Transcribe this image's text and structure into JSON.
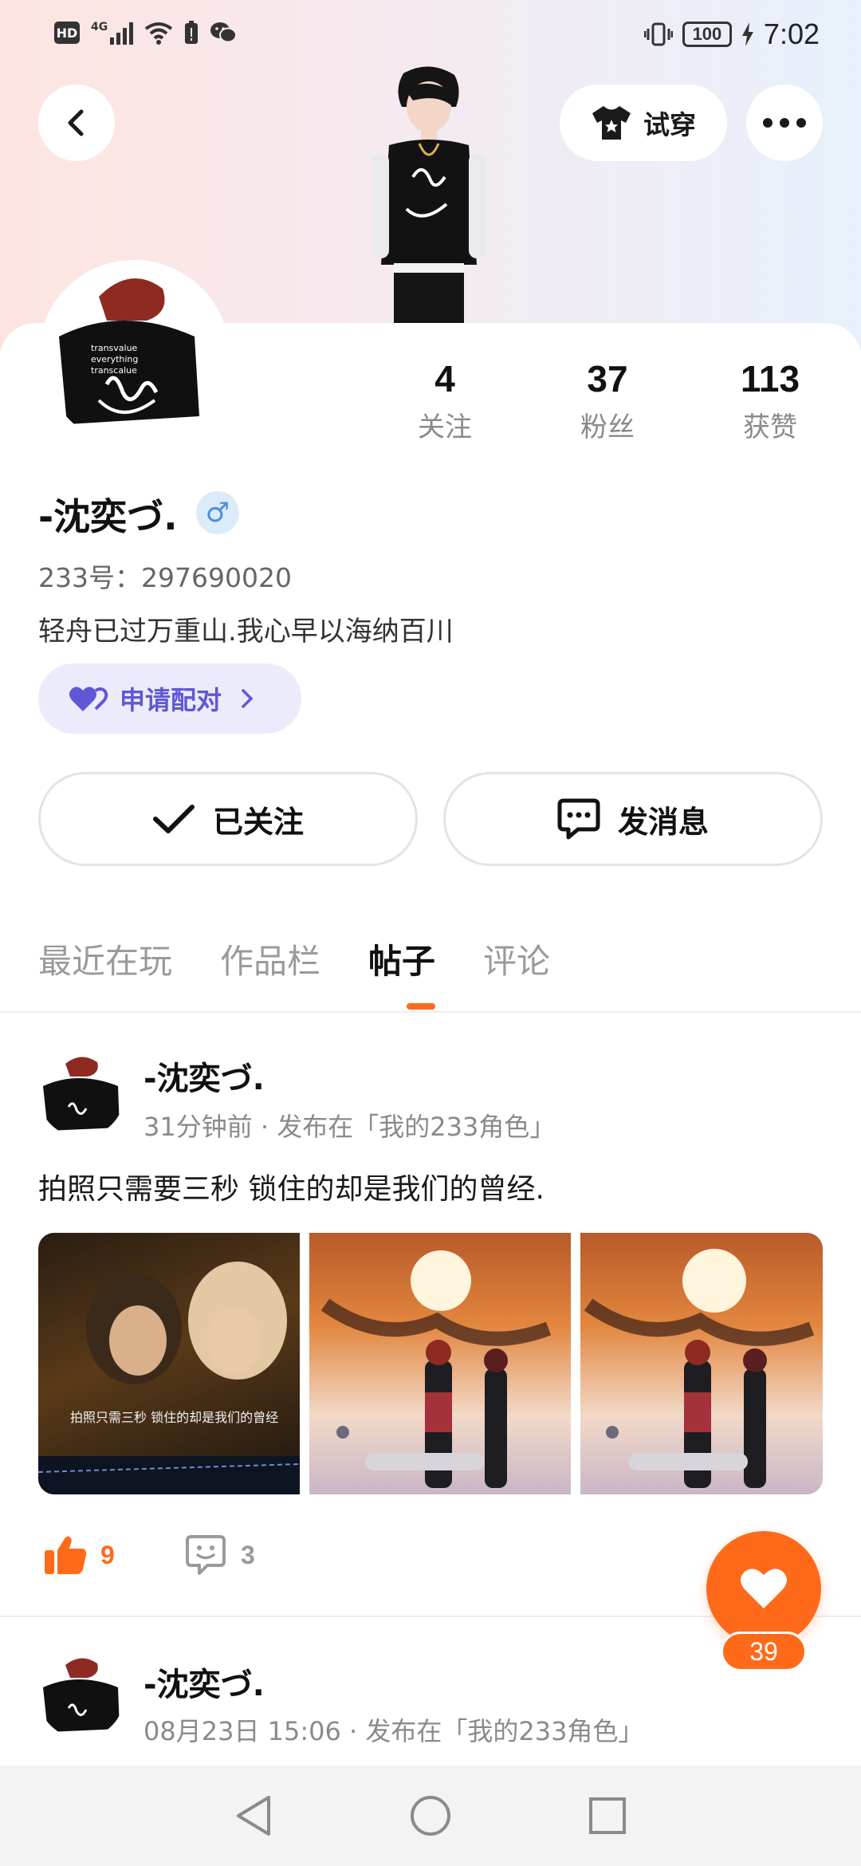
{
  "status_bar": {
    "left_labels": [
      "HD",
      "4G"
    ],
    "battery_level": "100",
    "time": "7:02"
  },
  "header": {
    "tryon_label": "试穿"
  },
  "profile": {
    "stats": [
      {
        "value": "4",
        "label": "关注"
      },
      {
        "value": "37",
        "label": "粉丝"
      },
      {
        "value": "113",
        "label": "获赞"
      }
    ],
    "username": "-沈奕づ.",
    "gender_symbol": "♂",
    "user_id": "233号：297690020",
    "bio": "轻舟已过万重山.我心早以海纳百川",
    "pair_label": "申请配对",
    "follow_label": "已关注",
    "message_label": "发消息",
    "avatar_shirt_text": [
      "transvalue",
      "everything",
      "transcalue"
    ]
  },
  "tabs": [
    {
      "label": "最近在玩",
      "active": false
    },
    {
      "label": "作品栏",
      "active": false
    },
    {
      "label": "帖子",
      "active": true
    },
    {
      "label": "评论",
      "active": false
    }
  ],
  "posts": [
    {
      "author": "-沈奕づ.",
      "meta": "31分钟前 · 发布在「我的233角色」",
      "text": "拍照只需要三秒 锁住的却是我们的曾经.",
      "image_caption": "拍照只需三秒 锁住的却是我们的曾经",
      "likes": "9",
      "comments": "3"
    },
    {
      "author": "-沈奕づ.",
      "meta": "08月23日 15:06 · 发布在「我的233角色」"
    }
  ],
  "favorite_count": "39",
  "colors": {
    "accent": "#ff6a1a",
    "pair_purple": "#5f57d6",
    "gender_blue": "#4a8fdc"
  }
}
